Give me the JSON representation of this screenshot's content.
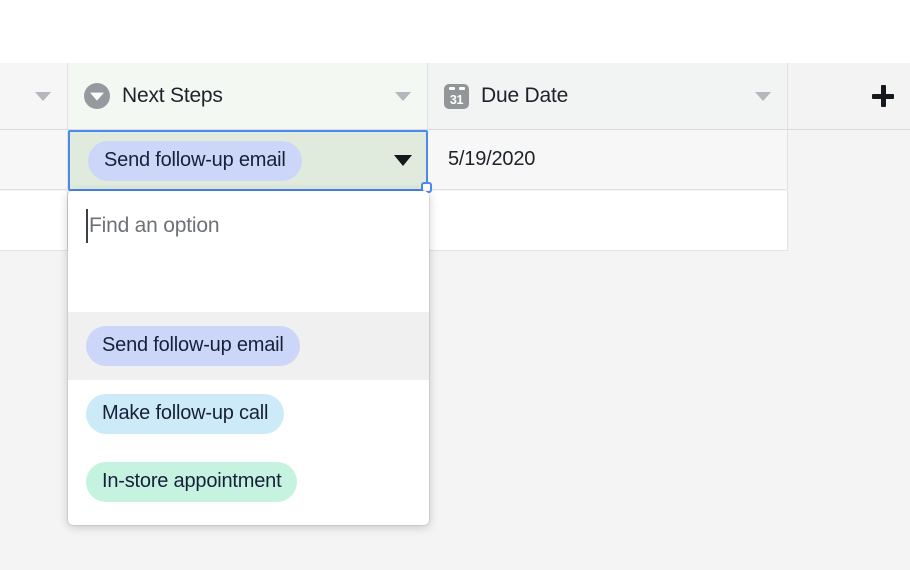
{
  "grid": {
    "columns": [
      {
        "id": "partial-left",
        "label": "",
        "field_icon": "none",
        "has_menu_caret": true
      },
      {
        "id": "next-steps",
        "label": "Next Steps",
        "field_icon": "single-select-icon",
        "has_menu_caret": true
      },
      {
        "id": "due-date",
        "label": "Due Date",
        "field_icon": "calendar-icon",
        "calendar_day": "31",
        "has_menu_caret": true
      }
    ],
    "add_field_button_label": "+",
    "rows": [
      {
        "next_steps": "Send follow-up email",
        "next_steps_pill_color": "#ccd6f8",
        "due_date": "5/19/2020",
        "selected": true
      },
      {
        "next_steps": "",
        "due_date": "",
        "selected": false
      }
    ]
  },
  "dropdown": {
    "search_placeholder": "Find an option",
    "search_value": "",
    "options": [
      {
        "label": "Send follow-up email",
        "color": "#ccd6f8",
        "highlighted": true
      },
      {
        "label": "Make follow-up call",
        "color": "#cdeaf8",
        "highlighted": false
      },
      {
        "label": "In-store appointment",
        "color": "#c6f2e0",
        "highlighted": false
      }
    ]
  },
  "theme": {
    "selection_border": "#4b89f0",
    "active_cell_bg": "#e1ebdd",
    "header_select_bg": "#f3f8f3",
    "row_hover_bg": "#f0f0f0",
    "text_color": "#1f2329"
  }
}
